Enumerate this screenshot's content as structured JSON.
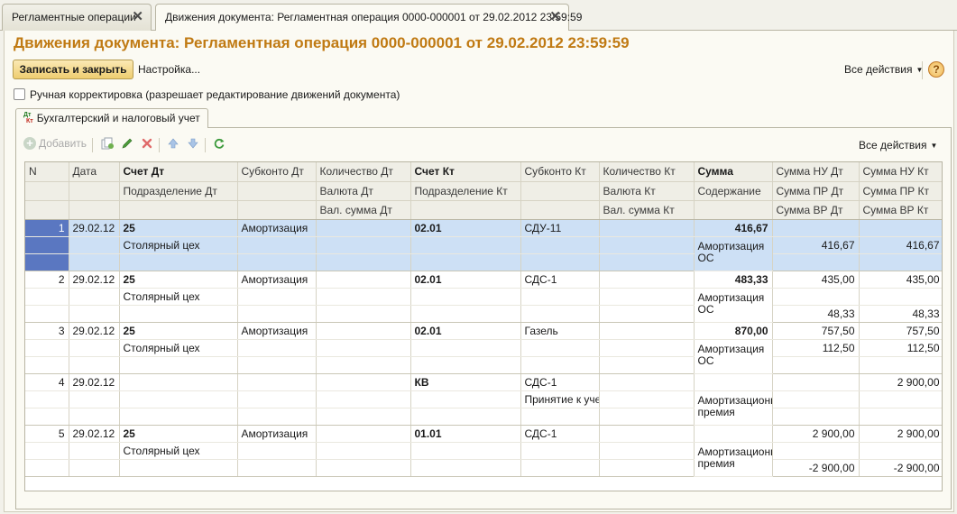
{
  "tabs": [
    {
      "label": "Регламентные операции"
    },
    {
      "label": "Движения документа: Регламентная операция 0000-000001 от 29.02.2012 23:59:59"
    }
  ],
  "title": "Движения документа: Регламентная операция 0000-000001 от 29.02.2012 23:59:59",
  "toolbar": {
    "save_close": "Записать и закрыть",
    "settings": "Настройка...",
    "all_actions": "Все действия",
    "help": "?"
  },
  "manual_edit": {
    "label": "Ручная корректировка (разрешает редактирование движений документа)",
    "checked": false
  },
  "inner_tab": {
    "label": "Бухгалтерский и налоговый учет",
    "icon_dt": "Дт",
    "icon_kt": "Кт"
  },
  "grid_toolbar": {
    "add": "Добавить",
    "all_actions": "Все действия"
  },
  "columns": {
    "row1": [
      "N",
      "Дата",
      "Счет Дт",
      "Субконто Дт",
      "Количество Дт",
      "Счет Кт",
      "Субконто Кт",
      "Количество Кт",
      "Сумма",
      "Сумма НУ Дт",
      "Сумма НУ Кт"
    ],
    "row2": [
      "",
      "",
      "Подразделение Дт",
      "",
      "Валюта Дт",
      "Подразделение Кт",
      "",
      "Валюта Кт",
      "Содержание",
      "Сумма ПР Дт",
      "Сумма ПР Кт"
    ],
    "row3": [
      "",
      "",
      "",
      "",
      "Вал. сумма Дт",
      "",
      "",
      "Вал. сумма Кт",
      "",
      "Сумма ВР Дт",
      "Сумма ВР Кт"
    ]
  },
  "rows": [
    {
      "n": "1",
      "date": "29.02.12",
      "acc_dt": "25",
      "sub_dt": "Амортизация",
      "acc_kt": "02.01",
      "sub_kt": "СДУ-11",
      "sum": "416,67",
      "div_dt": "Столярный цех",
      "div_kt": "",
      "content": "Амортизация ОС",
      "nu_dt": "",
      "nu_kt": "",
      "pr_dt": "416,67",
      "pr_kt": "416,67",
      "vr_dt": "",
      "vr_kt": "",
      "selected": true
    },
    {
      "n": "2",
      "date": "29.02.12",
      "acc_dt": "25",
      "sub_dt": "Амортизация",
      "acc_kt": "02.01",
      "sub_kt": "СДС-1",
      "sum": "483,33",
      "div_dt": "Столярный цех",
      "div_kt": "",
      "content": "Амортизация ОС",
      "nu_dt": "435,00",
      "nu_kt": "435,00",
      "pr_dt": "",
      "pr_kt": "",
      "vr_dt": "48,33",
      "vr_kt": "48,33",
      "selected": false
    },
    {
      "n": "3",
      "date": "29.02.12",
      "acc_dt": "25",
      "sub_dt": "Амортизация",
      "acc_kt": "02.01",
      "sub_kt": "Газель",
      "sum": "870,00",
      "div_dt": "Столярный цех",
      "div_kt": "",
      "content": "Амортизация ОС",
      "nu_dt": "757,50",
      "nu_kt": "757,50",
      "pr_dt": "112,50",
      "pr_kt": "112,50",
      "vr_dt": "",
      "vr_kt": "",
      "selected": false
    },
    {
      "n": "4",
      "date": "29.02.12",
      "acc_dt": "",
      "sub_dt": "",
      "acc_kt": "КВ",
      "sub_kt": "СДС-1",
      "sum": "",
      "div_dt": "",
      "div_kt": "Принятие к учет",
      "content": "Амортизационн премия",
      "nu_dt": "",
      "nu_kt": "2 900,00",
      "pr_dt": "",
      "pr_kt": "",
      "vr_dt": "",
      "vr_kt": "",
      "selected": false
    },
    {
      "n": "5",
      "date": "29.02.12",
      "acc_dt": "25",
      "sub_dt": "Амортизация",
      "acc_kt": "01.01",
      "sub_kt": "СДС-1",
      "sum": "",
      "div_dt": "Столярный цех",
      "div_kt": "",
      "content": "Амортизационн премия",
      "nu_dt": "2 900,00",
      "nu_kt": "2 900,00",
      "pr_dt": "",
      "pr_kt": "",
      "vr_dt": "-2 900,00",
      "vr_kt": "-2 900,00",
      "selected": false
    }
  ],
  "colors": {
    "title": "#c07a13",
    "selection": "#cde0f5",
    "selection_marker": "#5a77c1",
    "header_bg": "#efeee6"
  }
}
